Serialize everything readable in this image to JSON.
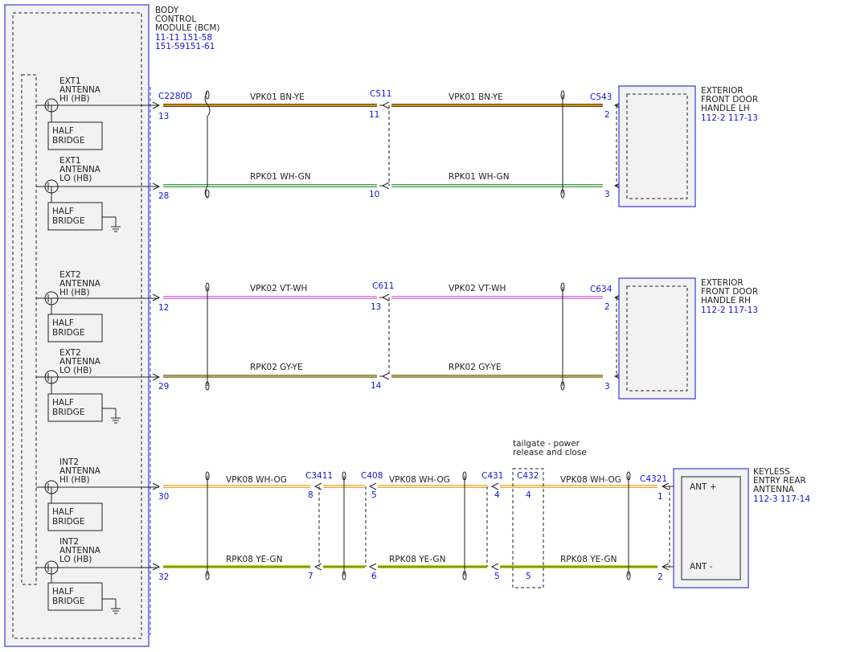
{
  "bcm": {
    "title_line1": "BODY",
    "title_line2": "CONTROL",
    "title_line3": "MODULE (BCM)",
    "ref_line1": "11-11  151-58",
    "ref_line2": "151-59151-61",
    "antennas": [
      {
        "line1": "EXT1",
        "line2": "ANTENNA",
        "line3": "HI (HB)",
        "bridge1": "HALF",
        "bridge2": "BRIDGE",
        "grounded": false
      },
      {
        "line1": "EXT1",
        "line2": "ANTENNA",
        "line3": "LO (HB)",
        "bridge1": "HALF",
        "bridge2": "BRIDGE",
        "grounded": true
      },
      {
        "line1": "EXT2",
        "line2": "ANTENNA",
        "line3": "HI (HB)",
        "bridge1": "HALF",
        "bridge2": "BRIDGE",
        "grounded": false
      },
      {
        "line1": "EXT2",
        "line2": "ANTENNA",
        "line3": "LO (HB)",
        "bridge1": "HALF",
        "bridge2": "BRIDGE",
        "grounded": true
      },
      {
        "line1": "INT2",
        "line2": "ANTENNA",
        "line3": "HI (HB)",
        "bridge1": "HALF",
        "bridge2": "BRIDGE",
        "grounded": false
      },
      {
        "line1": "INT2",
        "line2": "ANTENNA",
        "line3": "LO (HB)",
        "bridge1": "HALF",
        "bridge2": "BRIDGE",
        "grounded": true
      }
    ]
  },
  "connectors": {
    "c2280d": "C2280D",
    "c511": "C511",
    "c543": "C543",
    "c611": "C611",
    "c634": "C634",
    "c3411": "C3411",
    "c408": "C408",
    "c431": "C431",
    "c432": "C432",
    "c4321": "C4321"
  },
  "pins": {
    "p13": "13",
    "p11": "11",
    "p2a": "2",
    "p28": "28",
    "p10": "10",
    "p3a": "3",
    "p12": "12",
    "p13b": "13",
    "p2b": "2",
    "p29": "29",
    "p14": "14",
    "p3b": "3",
    "p30": "30",
    "p8": "8",
    "p5a": "5",
    "p4a": "4",
    "p4b": "4",
    "p1": "1",
    "p32": "32",
    "p7": "7",
    "p6": "6",
    "p5b": "5",
    "p5c": "5",
    "p2c": "2"
  },
  "wires": {
    "w1": "VPK01   BN-YE",
    "w2": "RPK01   WH-GN",
    "w3": "VPK02   VT-WH",
    "w4": "RPK02   GY-YE",
    "w5": "VPK08   WH-OG",
    "w6": "RPK08   YE-GN"
  },
  "components": {
    "lh": {
      "line1": "EXTERIOR",
      "line2": "FRONT DOOR",
      "line3": "HANDLE LH",
      "ref": "112-2  117-13"
    },
    "rh": {
      "line1": "EXTERIOR",
      "line2": "FRONT DOOR",
      "line3": "HANDLE RH",
      "ref": "112-2  117-13"
    },
    "rear": {
      "line1": "KEYLESS",
      "line2": "ENTRY REAR",
      "line3": "ANTENNA",
      "ref": "112-3  117-14",
      "ant_plus": "ANT +",
      "ant_minus": "ANT -"
    }
  },
  "tailgate": {
    "line1": "tailgate - power",
    "line2": "release and close"
  },
  "colors": {
    "connector_label": "#1515d2",
    "bn_ye": [
      "#7a3b12",
      "#e3c21b"
    ],
    "wh_gn": [
      "#e8f5e8",
      "#3f9a46"
    ],
    "vt_wh": [
      "#d67bd8",
      "#f6e2f6"
    ],
    "gy_ye": [
      "#8a8a72",
      "#c8b31d"
    ],
    "wh_og": [
      "#fbf1dc",
      "#e9a93f"
    ],
    "ye_gn": [
      "#c6d217",
      "#4a8c1e"
    ]
  }
}
